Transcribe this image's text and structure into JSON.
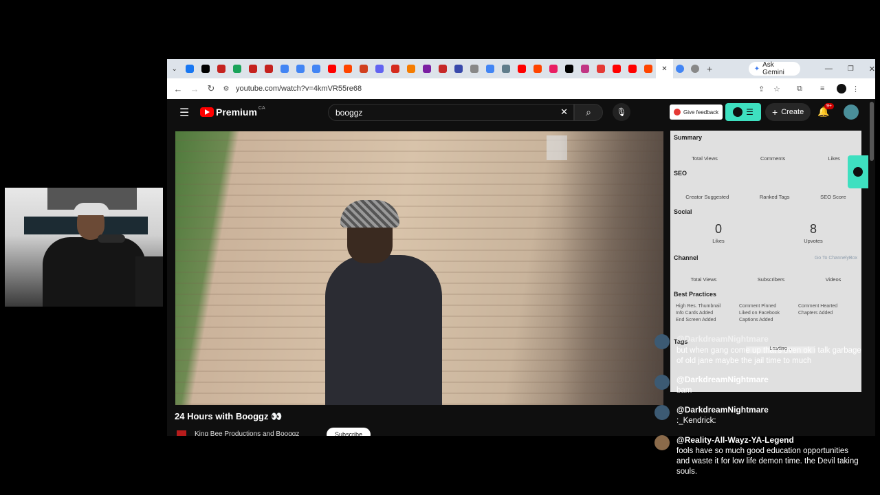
{
  "browser": {
    "tab_favicons": [
      {
        "name": "facebook-icon",
        "color": "#1877f2"
      },
      {
        "name": "x-icon",
        "color": "#000000"
      },
      {
        "name": "gmail-icon",
        "color": "#c5221f"
      },
      {
        "name": "green-app-icon",
        "color": "#1aa35a"
      },
      {
        "name": "gmail-icon",
        "color": "#c5221f"
      },
      {
        "name": "gmail-icon",
        "color": "#c5221f"
      },
      {
        "name": "docs-icon",
        "color": "#4285f4"
      },
      {
        "name": "docs-icon",
        "color": "#4285f4"
      },
      {
        "name": "docs-icon",
        "color": "#4285f4"
      },
      {
        "name": "youtube-icon",
        "color": "#ff0000"
      },
      {
        "name": "reddit-icon",
        "color": "#ff4500"
      },
      {
        "name": "app-icon",
        "color": "#d1401f"
      },
      {
        "name": "app-icon",
        "color": "#6263f1"
      },
      {
        "name": "maple-icon",
        "color": "#d52b1e"
      },
      {
        "name": "app-icon",
        "color": "#f57c00"
      },
      {
        "name": "app-icon",
        "color": "#7b1fa2"
      },
      {
        "name": "app-icon",
        "color": "#c62828"
      },
      {
        "name": "app-icon",
        "color": "#3949ab"
      },
      {
        "name": "app-icon",
        "color": "#888888"
      },
      {
        "name": "google-icon",
        "color": "#4285f4"
      },
      {
        "name": "globe-icon",
        "color": "#607d8b"
      },
      {
        "name": "youtube-icon",
        "color": "#ff0000"
      },
      {
        "name": "reddit-icon",
        "color": "#ff4500"
      },
      {
        "name": "app-icon",
        "color": "#e91e63"
      },
      {
        "name": "x-icon",
        "color": "#000000"
      },
      {
        "name": "instagram-icon",
        "color": "#c13584"
      },
      {
        "name": "app-icon",
        "color": "#e53935"
      },
      {
        "name": "youtube-icon",
        "color": "#ff0000"
      },
      {
        "name": "youtube-icon",
        "color": "#ff0000"
      },
      {
        "name": "reddit-icon",
        "color": "#ff4500"
      }
    ],
    "active_tab_close": "✕",
    "ask_gemini": "Ask Gemini",
    "url": "youtube.com/watch?v=4kmVR55re68"
  },
  "youtube": {
    "logo_text": "Premium",
    "logo_region": "CA",
    "search_value": "booggz",
    "give_feedback": "Give feedback",
    "create_label": "Create",
    "notif_count": "9+",
    "video_title": "24 Hours with Booggz 👀",
    "channel_name": "King Bee Productions and Booggz",
    "subscribe_label": "Subscribe"
  },
  "panel": {
    "summary": "Summary",
    "summary_labels": [
      "Total Views",
      "Comments",
      "Likes"
    ],
    "seo": "SEO",
    "seo_labels": [
      "Creator Suggested",
      "Ranked Tags",
      "SEO Score"
    ],
    "social": "Social",
    "likes_value": "0",
    "likes_label": "Likes",
    "upvotes_value": "8",
    "upvotes_label": "Upvotes",
    "channel": "Channel",
    "channel_link": "Go To ChannelyBox",
    "channel_labels": [
      "Total Views",
      "Subscribers",
      "Videos"
    ],
    "best_practices": "Best Practices",
    "best_practice_items": [
      "High Res. Thumbnail",
      "Comment Pinned",
      "Comment Hearted",
      "Info Cards Added",
      "Liked on Facebook",
      "Chapters Added",
      "End Screen Added",
      "Captions Added"
    ],
    "tags": "Tags",
    "loading": "Loading..."
  },
  "chat": [
    {
      "name": "@DarkdreamNightmare",
      "text": "but when gang come up that's even ok i talk garbage of old jane maybe the jail time to much"
    },
    {
      "name": "@DarkdreamNightmare",
      "text": "bam"
    },
    {
      "name": "@DarkdreamNightmare",
      "text": ":_Kendrick:"
    },
    {
      "name": "@Reality-All-Wayz-YA-Legend",
      "text": "fools have so much good education opportunities and waste it for low life demon time. the Devil taking souls."
    }
  ]
}
